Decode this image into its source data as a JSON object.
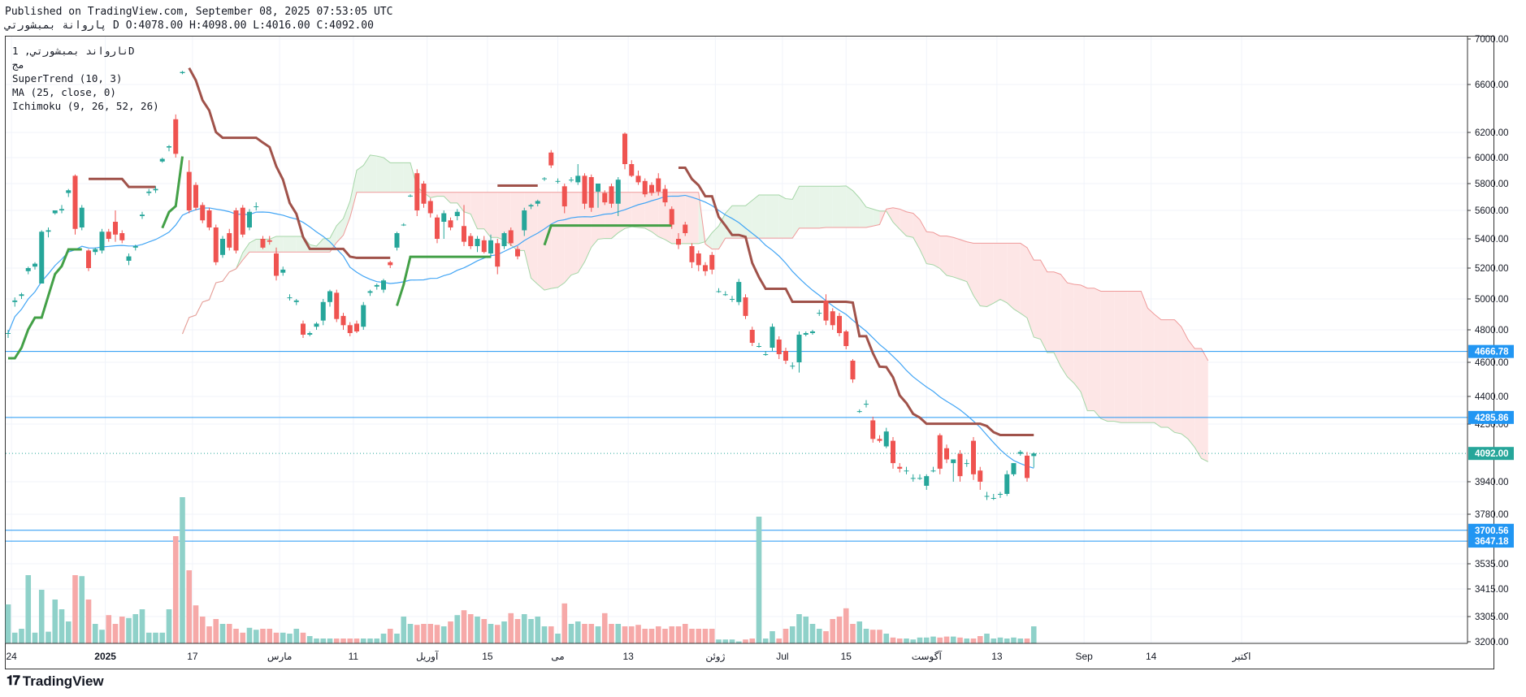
{
  "header": {
    "line1": "Published on TradingView.com, September 08, 2025 07:53:05 UTC",
    "line2": "پاروانة بمبشورتي D O:4078.00 H:4098.00 L:4016.00 C:4092.00"
  },
  "legend": {
    "symbol": "نارواند بمبشورتي, 1D",
    "sub": "مج",
    "indicators": [
      "SuperTrend (10, 3)",
      "MA (25, close, 0)",
      "Ichimoku (9, 26, 52, 26)"
    ]
  },
  "footer": {
    "brand": "TradingView",
    "logo": "tradingview-logo-icon"
  },
  "colors": {
    "up": "#26a69a",
    "down": "#ef5350",
    "st_up": "#43a047",
    "st_down": "#a0524a",
    "ma": "#42a5f5",
    "hline": "#2196f3",
    "cloud_up": "#e8f5e9",
    "cloud_down": "#fde6e6"
  },
  "chart_data": {
    "type": "candlestick",
    "title": "",
    "y_ticks": [
      7000,
      6600,
      6200,
      6000,
      5800,
      5600,
      5400,
      5200,
      5000,
      4800,
      4600,
      4400,
      4250,
      3940,
      3780,
      3535,
      3415,
      3305,
      3200
    ],
    "y_tick_labels": [
      "7000.00",
      "6600.00",
      "6200.00",
      "6000.00",
      "5800.00",
      "5600.00",
      "5400.00",
      "5200.00",
      "5000.00",
      "4800.00",
      "4600.00",
      "4400.00",
      "4250.00",
      "3940.00",
      "3780.00",
      "3535.00",
      "3415.00",
      "3305.00",
      "3200.00"
    ],
    "x_labels": [
      "24",
      "2025",
      "17",
      "مارس",
      "11",
      "آوریل",
      "15",
      "می",
      "13",
      "ژوئن",
      "Jul",
      "15",
      "آگوست",
      "13",
      "Sep",
      "14",
      "اکتبر"
    ],
    "x_label_pos": [
      0.5,
      14.5,
      27.5,
      40.5,
      51.5,
      62.5,
      71.5,
      82,
      92.5,
      105.5,
      115.5,
      125,
      137,
      147.5,
      160.5,
      170.5,
      184
    ],
    "price_lines": [
      {
        "value": 4666.78,
        "label": "4666.78"
      },
      {
        "value": 4285.86,
        "label": "4285.86"
      },
      {
        "value": 3700.56,
        "label": "3700.56"
      },
      {
        "value": 3647.18,
        "label": "3647.18"
      }
    ],
    "last_price": {
      "value": 4092.0,
      "label": "4092.00"
    },
    "candles": [
      [
        4780,
        4800,
        4750,
        4780
      ],
      [
        4980,
        5010,
        4950,
        4990
      ],
      [
        5020,
        5040,
        5000,
        5030
      ],
      [
        5180,
        5210,
        5160,
        5200
      ],
      [
        5210,
        5240,
        5190,
        5230
      ],
      [
        5100,
        5460,
        5100,
        5450
      ],
      [
        5450,
        5480,
        5410,
        5460
      ],
      [
        5580,
        5600,
        5570,
        5600
      ],
      [
        5600,
        5640,
        5580,
        5610
      ],
      [
        5730,
        5760,
        5700,
        5750
      ],
      [
        5860,
        5870,
        5430,
        5470
      ],
      [
        5480,
        5640,
        5460,
        5620
      ],
      [
        5320,
        5330,
        5180,
        5200
      ],
      [
        5310,
        5340,
        5290,
        5330
      ],
      [
        5320,
        5470,
        5300,
        5450
      ],
      [
        5450,
        5470,
        5380,
        5400
      ],
      [
        5520,
        5600,
        5380,
        5430
      ],
      [
        5440,
        5460,
        5370,
        5390
      ],
      [
        5250,
        5300,
        5220,
        5280
      ],
      [
        5340,
        5360,
        5320,
        5350
      ],
      [
        5560,
        5590,
        5540,
        5570
      ],
      [
        5730,
        5760,
        5710,
        5740
      ],
      [
        5750,
        5780,
        5730,
        5760
      ],
      [
        5970,
        6000,
        5960,
        5990
      ],
      [
        6080,
        6100,
        6050,
        6090
      ],
      [
        6310,
        6350,
        6000,
        6030
      ],
      [
        6700,
        6720,
        6690,
        6710
      ],
      [
        5890,
        5980,
        5580,
        5600
      ],
      [
        5790,
        5810,
        5600,
        5620
      ],
      [
        5640,
        5660,
        5510,
        5530
      ],
      [
        5600,
        5620,
        5460,
        5480
      ],
      [
        5480,
        5500,
        5220,
        5240
      ],
      [
        5290,
        5420,
        5270,
        5400
      ],
      [
        5440,
        5470,
        5320,
        5340
      ],
      [
        5600,
        5620,
        5300,
        5320
      ],
      [
        5620,
        5640,
        5410,
        5430
      ],
      [
        5480,
        5610,
        5460,
        5590
      ],
      [
        5630,
        5660,
        5600,
        5630
      ],
      [
        5400,
        5420,
        5330,
        5340
      ],
      [
        5390,
        5420,
        5360,
        5380
      ],
      [
        5300,
        5340,
        5120,
        5150
      ],
      [
        5170,
        5210,
        5150,
        5190
      ],
      [
        5010,
        5030,
        4990,
        5010
      ],
      [
        4980,
        5000,
        4960,
        4990
      ],
      [
        4840,
        4860,
        4750,
        4770
      ],
      [
        4770,
        4790,
        4760,
        4780
      ],
      [
        4820,
        4850,
        4800,
        4840
      ],
      [
        4860,
        5000,
        4830,
        4980
      ],
      [
        4980,
        5060,
        4950,
        5050
      ],
      [
        5040,
        5060,
        4850,
        4870
      ],
      [
        4890,
        4910,
        4800,
        4830
      ],
      [
        4830,
        4850,
        4760,
        4780
      ],
      [
        4840,
        4860,
        4780,
        4790
      ],
      [
        4820,
        4980,
        4800,
        4960
      ],
      [
        5040,
        5060,
        5020,
        5050
      ],
      [
        5080,
        5100,
        5060,
        5090
      ],
      [
        5060,
        5130,
        5040,
        5120
      ],
      [
        5240,
        5250,
        5200,
        5220
      ],
      [
        5340,
        5450,
        5320,
        5440
      ],
      [
        5500,
        5510,
        5490,
        5500
      ],
      [
        5710,
        5720,
        5700,
        5710
      ],
      [
        5880,
        5910,
        5560,
        5600
      ],
      [
        5800,
        5820,
        5620,
        5650
      ],
      [
        5670,
        5690,
        5550,
        5580
      ],
      [
        5550,
        5570,
        5370,
        5400
      ],
      [
        5520,
        5600,
        5400,
        5580
      ],
      [
        5530,
        5550,
        5460,
        5480
      ],
      [
        5560,
        5610,
        5530,
        5590
      ],
      [
        5490,
        5640,
        5350,
        5380
      ],
      [
        5420,
        5440,
        5330,
        5350
      ],
      [
        5350,
        5420,
        5310,
        5400
      ],
      [
        5390,
        5420,
        5300,
        5310
      ],
      [
        5300,
        5430,
        5270,
        5390
      ],
      [
        5370,
        5400,
        5160,
        5210
      ],
      [
        5350,
        5450,
        5330,
        5440
      ],
      [
        5460,
        5480,
        5350,
        5370
      ],
      [
        5330,
        5350,
        5260,
        5280
      ],
      [
        5460,
        5620,
        5420,
        5600
      ],
      [
        5630,
        5650,
        5610,
        5640
      ],
      [
        5650,
        5680,
        5630,
        5670
      ],
      [
        5840,
        5850,
        5820,
        5840
      ],
      [
        6040,
        6060,
        5920,
        5940
      ],
      [
        5820,
        5840,
        5800,
        5820
      ],
      [
        5780,
        5800,
        5580,
        5630
      ],
      [
        5830,
        5850,
        5810,
        5830
      ],
      [
        5810,
        5950,
        5790,
        5860
      ],
      [
        5860,
        5880,
        5610,
        5650
      ],
      [
        5850,
        5870,
        5590,
        5620
      ],
      [
        5740,
        5800,
        5620,
        5800
      ],
      [
        5730,
        5750,
        5640,
        5660
      ],
      [
        5780,
        5800,
        5620,
        5650
      ],
      [
        5650,
        5850,
        5560,
        5830
      ],
      [
        6190,
        6200,
        5910,
        5950
      ],
      [
        5950,
        5980,
        5850,
        5860
      ],
      [
        5860,
        5900,
        5790,
        5810
      ],
      [
        5820,
        5840,
        5700,
        5720
      ],
      [
        5790,
        5810,
        5710,
        5730
      ],
      [
        5840,
        5880,
        5710,
        5740
      ],
      [
        5760,
        5790,
        5630,
        5660
      ],
      [
        5610,
        5630,
        5470,
        5500
      ],
      [
        5400,
        5440,
        5330,
        5360
      ],
      [
        5500,
        5520,
        5420,
        5440
      ],
      [
        5350,
        5370,
        5200,
        5240
      ],
      [
        5300,
        5320,
        5180,
        5220
      ],
      [
        5220,
        5240,
        5150,
        5180
      ],
      [
        5290,
        5310,
        5160,
        5190
      ],
      [
        5050,
        5070,
        5040,
        5050
      ],
      [
        5030,
        5050,
        5020,
        5030
      ],
      [
        5000,
        5020,
        4980,
        5000
      ],
      [
        4980,
        5130,
        4960,
        5110
      ],
      [
        5010,
        5030,
        4870,
        4890
      ],
      [
        4800,
        4820,
        4700,
        4720
      ],
      [
        4700,
        4720,
        4690,
        4700
      ],
      [
        4650,
        4670,
        4640,
        4650
      ],
      [
        4690,
        4840,
        4670,
        4820
      ],
      [
        4740,
        4760,
        4620,
        4650
      ],
      [
        4670,
        4690,
        4590,
        4610
      ],
      [
        4580,
        4600,
        4560,
        4580
      ],
      [
        4600,
        4790,
        4540,
        4770
      ],
      [
        4770,
        4790,
        4760,
        4780
      ],
      [
        4780,
        4800,
        4770,
        4790
      ],
      [
        4910,
        4930,
        4890,
        4910
      ],
      [
        4990,
        5030,
        4830,
        4860
      ],
      [
        4920,
        4940,
        4800,
        4830
      ],
      [
        4890,
        4910,
        4760,
        4780
      ],
      [
        4790,
        4800,
        4680,
        4700
      ],
      [
        4610,
        4620,
        4480,
        4500
      ],
      [
        4320,
        4330,
        4310,
        4320
      ],
      [
        4360,
        4380,
        4340,
        4360
      ],
      [
        4270,
        4290,
        4150,
        4170
      ],
      [
        4170,
        4190,
        4150,
        4160
      ],
      [
        4130,
        4230,
        4120,
        4210
      ],
      [
        4160,
        4180,
        4010,
        4040
      ],
      [
        4020,
        4040,
        3990,
        4010
      ],
      [
        4000,
        4020,
        3980,
        4000
      ],
      [
        3960,
        3980,
        3940,
        3960
      ],
      [
        3960,
        3980,
        3950,
        3960
      ],
      [
        3920,
        3980,
        3900,
        3970
      ],
      [
        4000,
        4020,
        3990,
        4000
      ],
      [
        4190,
        4200,
        3980,
        4010
      ],
      [
        4120,
        4140,
        4040,
        4060
      ],
      [
        4040,
        4060,
        3940,
        4060
      ],
      [
        4090,
        4110,
        3940,
        3970
      ],
      [
        4040,
        4060,
        4020,
        4040
      ],
      [
        4160,
        4180,
        3950,
        3980
      ],
      [
        4000,
        4020,
        3900,
        3940
      ],
      [
        3870,
        3890,
        3850,
        3870
      ],
      [
        3860,
        3880,
        3850,
        3860
      ],
      [
        3880,
        3890,
        3860,
        3880
      ],
      [
        3880,
        4000,
        3870,
        3980
      ],
      [
        3980,
        4040,
        3970,
        4040
      ],
      [
        4090,
        4110,
        4080,
        4100
      ],
      [
        4080,
        4100,
        3940,
        3960
      ],
      [
        4078,
        4098,
        4016,
        4092
      ]
    ],
    "volumes": [
      80,
      22,
      38,
      96,
      22,
      77,
      50,
      30,
      20,
      90,
      92,
      78,
      35,
      20,
      45,
      28,
      40,
      20,
      45,
      20,
      20,
      20,
      20,
      20,
      20,
      22,
      20,
      20,
      20,
      20,
      20,
      20,
      20,
      20,
      20,
      20,
      20,
      20,
      20,
      20,
      20,
      20,
      20,
      20,
      20,
      20,
      20,
      20,
      20,
      20,
      20,
      20,
      20,
      20,
      20,
      20,
      20,
      20,
      20,
      20,
      20,
      20,
      20,
      20,
      20,
      20,
      20,
      20,
      20,
      20,
      20,
      20,
      20,
      20,
      20,
      20,
      20,
      20,
      20,
      20,
      20,
      20,
      20,
      20,
      20,
      20,
      20,
      20,
      20,
      20,
      20,
      20,
      20,
      20,
      20,
      20,
      20,
      20,
      20,
      20,
      20,
      20,
      20,
      20,
      20,
      20,
      20,
      20,
      20,
      20,
      20,
      20,
      20,
      20,
      20,
      20,
      20,
      20,
      20,
      20,
      20,
      20,
      20,
      20,
      20,
      20,
      20,
      20,
      20,
      20,
      20,
      20,
      20,
      20,
      20,
      20,
      20,
      20,
      20,
      20,
      20,
      20,
      20,
      20,
      20,
      20,
      20,
      20,
      20,
      20,
      20,
      20,
      20
    ],
    "volume_overrides": {
      "2": 30,
      "3": 140,
      "4": 22,
      "5": 110,
      "6": 24,
      "7": 90,
      "8": 70,
      "9": 45,
      "10": 140,
      "11": 138,
      "12": 90,
      "13": 40,
      "14": 28,
      "15": 58,
      "16": 40,
      "17": 55,
      "18": 52,
      "19": 60,
      "20": 70,
      "21": 22,
      "22": 22,
      "23": 22,
      "24": 70,
      "25": 220,
      "26": 300,
      "27": 150,
      "28": 78,
      "29": 55,
      "30": 35,
      "31": 50,
      "32": 40,
      "33": 40,
      "34": 30,
      "35": 22,
      "36": 32,
      "37": 28,
      "38": 30,
      "39": 30,
      "40": 22,
      "41": 22,
      "42": 20,
      "43": 30,
      "44": 22,
      "45": 15,
      "46": 10,
      "47": 10,
      "48": 10,
      "49": 10,
      "50": 10,
      "51": 10,
      "52": 10,
      "53": 10,
      "54": 10,
      "55": 10,
      "56": 20,
      "57": 30,
      "58": 20,
      "59": 55,
      "60": 40,
      "61": 38,
      "62": 40,
      "63": 40,
      "64": 38,
      "65": 35,
      "66": 45,
      "67": 58,
      "68": 68,
      "69": 60,
      "70": 55,
      "71": 50,
      "72": 40,
      "73": 38,
      "74": 45,
      "75": 62,
      "76": 50,
      "77": 60,
      "78": 50,
      "79": 55,
      "80": 35,
      "81": 35,
      "82": 20,
      "83": 82,
      "84": 40,
      "85": 45,
      "86": 40,
      "87": 40,
      "88": 35,
      "89": 62,
      "90": 40,
      "91": 40,
      "92": 35,
      "93": 35,
      "94": 38,
      "95": 30,
      "96": 30,
      "97": 35,
      "98": 30,
      "99": 35,
      "100": 35,
      "101": 40,
      "102": 30,
      "103": 30,
      "104": 30,
      "105": 30,
      "106": 8,
      "107": 8,
      "108": 8,
      "109": 4,
      "110": 8,
      "111": 10,
      "112": 260,
      "113": 10,
      "114": 25,
      "115": 10,
      "116": 30,
      "117": 35,
      "118": 60,
      "119": 55,
      "120": 40,
      "121": 30,
      "122": 25,
      "123": 50,
      "124": 55,
      "125": 72,
      "126": 40,
      "127": 45,
      "128": 30,
      "129": 28,
      "130": 28,
      "131": 20,
      "132": 12,
      "133": 10,
      "134": 10,
      "135": 8,
      "136": 12,
      "137": 12,
      "138": 14,
      "139": 12,
      "140": 14,
      "141": 14,
      "142": 12,
      "143": 10,
      "144": 10,
      "145": 15,
      "146": 20,
      "147": 10,
      "148": 12,
      "149": 10,
      "150": 12,
      "151": 10,
      "152": 10,
      "153": 35,
      "154": 18,
      "155": 8
    }
  }
}
